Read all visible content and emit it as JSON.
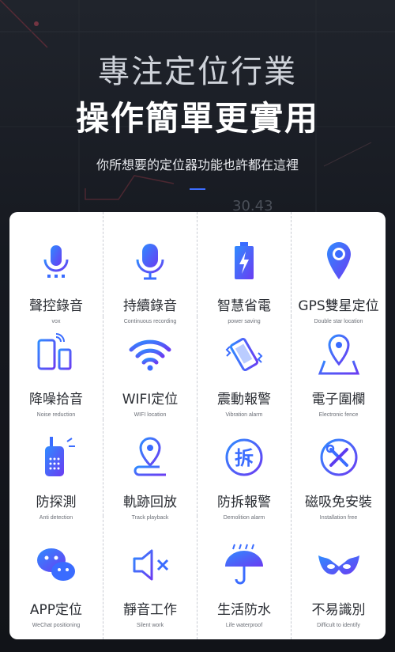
{
  "hero": {
    "title_line1": "專注定位行業",
    "title_line2": "操作簡單更實用",
    "subtitle": "你所想要的定位器功能也許都在這裡",
    "bg_number": "30.43"
  },
  "colors": {
    "accent_blue": "#3a6cff",
    "accent_purple": "#5b3cf0",
    "card_bg": "#ffffff"
  },
  "features": [
    {
      "label": "聲控錄音",
      "sublabel": "vox",
      "icon": "voice-mic-icon"
    },
    {
      "label": "持續錄音",
      "sublabel": "Continuous recording",
      "icon": "microphone-icon"
    },
    {
      "label": "智慧省電",
      "sublabel": "power saving",
      "icon": "battery-icon"
    },
    {
      "label": "GPS雙星定位",
      "sublabel": "Double star location",
      "icon": "location-pin-icon"
    },
    {
      "label": "降噪拾音",
      "sublabel": "Noise reduction",
      "icon": "phones-icon"
    },
    {
      "label": "WIFI定位",
      "sublabel": "WIFI location",
      "icon": "wifi-icon"
    },
    {
      "label": "震動報警",
      "sublabel": "Vibration alarm",
      "icon": "vibration-icon"
    },
    {
      "label": "電子圍欄",
      "sublabel": "Electronic fence",
      "icon": "map-pin-icon"
    },
    {
      "label": "防探測",
      "sublabel": "Anti detection",
      "icon": "walkie-talkie-icon"
    },
    {
      "label": "軌跡回放",
      "sublabel": "Track playback",
      "icon": "track-pin-icon"
    },
    {
      "label": "防拆報警",
      "sublabel": "Demolition alarm",
      "icon": "demolition-icon"
    },
    {
      "label": "磁吸免安裝",
      "sublabel": "Installation free",
      "icon": "tools-icon"
    },
    {
      "label": "APP定位",
      "sublabel": "WeChat positioning",
      "icon": "wechat-icon"
    },
    {
      "label": "靜音工作",
      "sublabel": "Silent work",
      "icon": "mute-icon"
    },
    {
      "label": "生活防水",
      "sublabel": "Life waterproof",
      "icon": "umbrella-icon"
    },
    {
      "label": "不易識別",
      "sublabel": "Difficult to identify",
      "icon": "mask-icon"
    }
  ]
}
